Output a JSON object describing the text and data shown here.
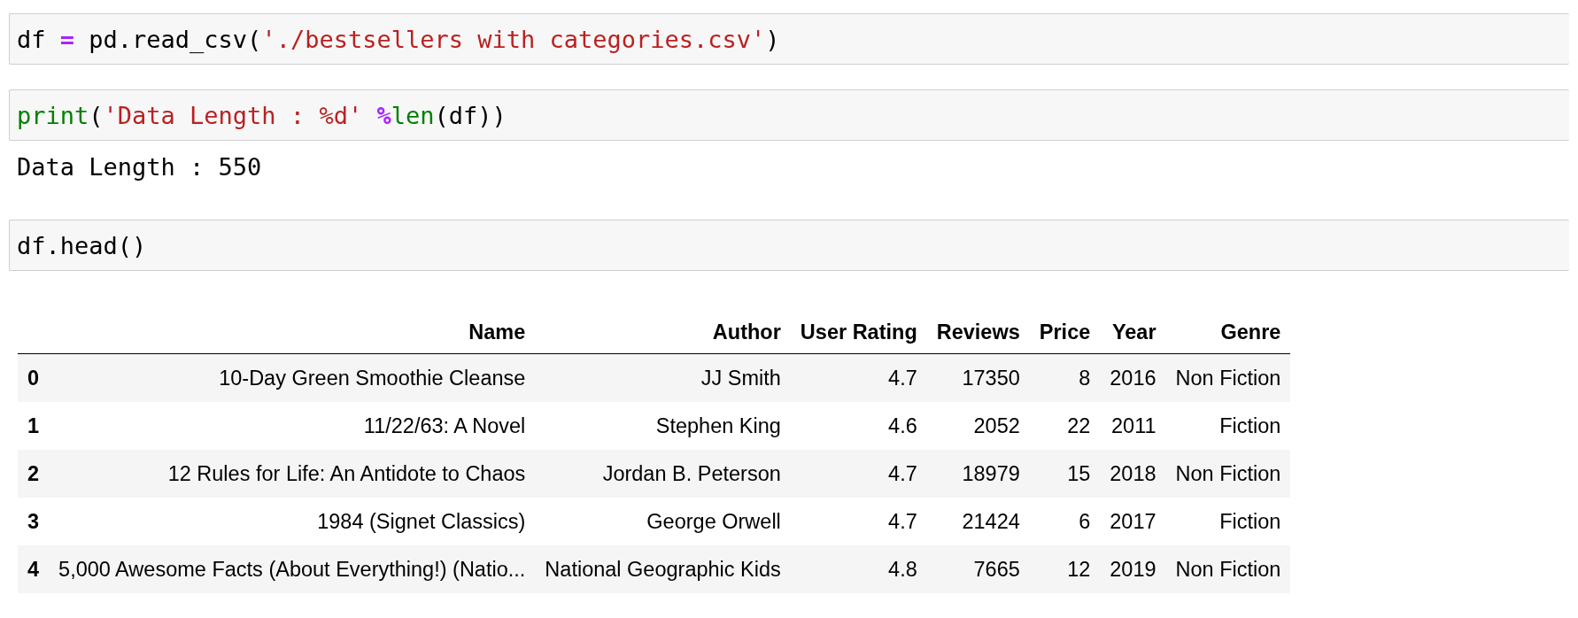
{
  "cells": [
    {
      "kind": "code",
      "tokens": [
        {
          "text": "df ",
          "kind": "name"
        },
        {
          "text": "=",
          "kind": "op"
        },
        {
          "text": " pd.read_csv(",
          "kind": "name"
        },
        {
          "text": "'./bestsellers with categories.csv'",
          "kind": "string"
        },
        {
          "text": ")",
          "kind": "name"
        }
      ]
    },
    {
      "kind": "code",
      "tokens": [
        {
          "text": "print",
          "kind": "builtin"
        },
        {
          "text": "(",
          "kind": "name"
        },
        {
          "text": "'Data Length : %d'",
          "kind": "string"
        },
        {
          "text": " %",
          "kind": "op"
        },
        {
          "text": "len",
          "kind": "builtin"
        },
        {
          "text": "(df))",
          "kind": "name"
        }
      ],
      "output": "Data Length : 550"
    },
    {
      "kind": "code",
      "tokens": [
        {
          "text": "df.head()",
          "kind": "name"
        }
      ],
      "table": {
        "columns": [
          "",
          "Name",
          "Author",
          "User Rating",
          "Reviews",
          "Price",
          "Year",
          "Genre"
        ],
        "rows": [
          [
            "0",
            "10-Day Green Smoothie Cleanse",
            "JJ Smith",
            "4.7",
            "17350",
            "8",
            "2016",
            "Non Fiction"
          ],
          [
            "1",
            "11/22/63: A Novel",
            "Stephen King",
            "4.6",
            "2052",
            "22",
            "2011",
            "Fiction"
          ],
          [
            "2",
            "12 Rules for Life: An Antidote to Chaos",
            "Jordan B. Peterson",
            "4.7",
            "18979",
            "15",
            "2018",
            "Non Fiction"
          ],
          [
            "3",
            "1984 (Signet Classics)",
            "George Orwell",
            "4.7",
            "21424",
            "6",
            "2017",
            "Fiction"
          ],
          [
            "4",
            "5,000 Awesome Facts (About Everything!) (Natio...",
            "National Geographic Kids",
            "4.8",
            "7665",
            "12",
            "2019",
            "Non Fiction"
          ]
        ]
      }
    }
  ]
}
